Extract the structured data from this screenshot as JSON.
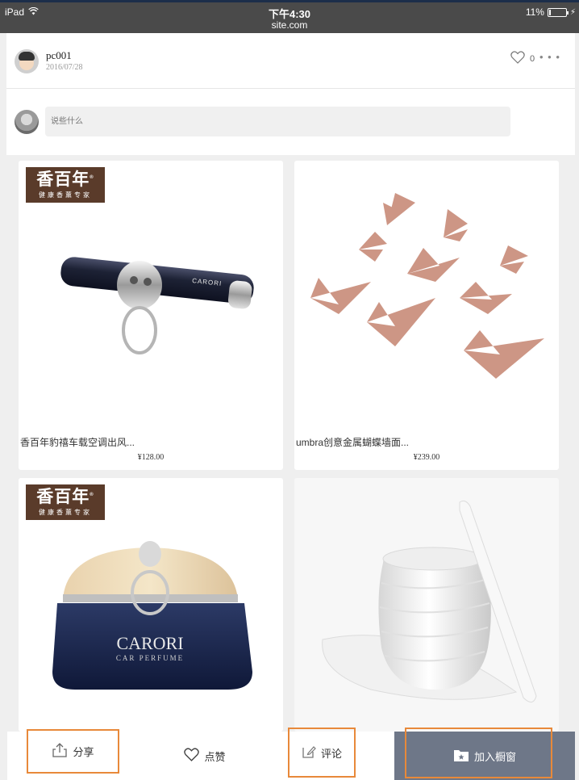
{
  "status_bar": {
    "device": "iPad",
    "time": "下午4:30",
    "url": "site.com",
    "battery": "11%",
    "battery_level": 0.11
  },
  "post": {
    "user_name": "pc001",
    "date": "2016/07/28",
    "like_count": "0",
    "comment_placeholder": "说些什么"
  },
  "products": [
    {
      "title": "香百年豹禧车载空调出风...",
      "price": "¥128.00",
      "brand_logo_text": "香百年",
      "brand_logo_sub": "健康香薰专家",
      "product_mark": "CARORI"
    },
    {
      "title": "umbra创意金属蝴蝶墙面...",
      "price": "¥239.00"
    },
    {
      "title": "",
      "price": "",
      "brand_logo_text": "香百年",
      "brand_logo_sub": "健康香薰专家",
      "product_mark": "CARORI",
      "product_mark_sub": "CAR PERFUME"
    },
    {
      "title": "",
      "price": ""
    }
  ],
  "bottom_bar": {
    "share_label": "分享",
    "like_label": "点赞",
    "comment_label": "评论",
    "add_label": "加入橱窗"
  },
  "colors": {
    "highlight_border": "#e8893a",
    "add_button_bg": "#6e7788",
    "butterfly": "#c88b78"
  },
  "icons": [
    "wifi-icon",
    "battery-icon",
    "heart-icon",
    "more-icon",
    "share-icon",
    "edit-icon",
    "folder-star-icon"
  ]
}
